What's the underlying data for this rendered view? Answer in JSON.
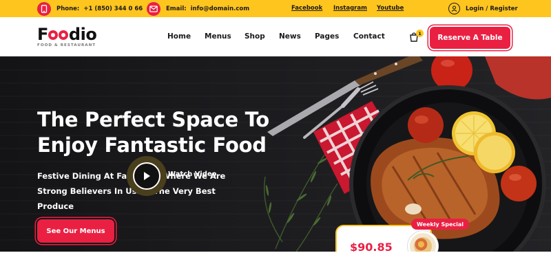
{
  "topbar": {
    "phone_label": "Phone:",
    "phone_value": "+1 (850) 344 0 66",
    "email_label": "Email:",
    "email_value": "info@domain.com",
    "social_links": [
      "Facebook",
      "Instagram",
      "Youtube"
    ],
    "login_label": "Login / Register"
  },
  "brand": {
    "name_start": "F",
    "name_end": "dio",
    "tagline": "FOOD & RESTAURANT"
  },
  "nav": {
    "items": [
      "Home",
      "Menus",
      "Shop",
      "News",
      "Pages",
      "Contact"
    ],
    "cart_count": "1",
    "reserve_label": "Reserve A Table"
  },
  "hero": {
    "title": "The Perfect Space To Enjoy Fantastic Food",
    "subtitle": "Festive Dining At Farthings Where We Are Strong Believers In Using The Very Best Produce",
    "menus_button": "See Our Menus",
    "watch_label": "Watch Video"
  },
  "promo": {
    "tag": "Weekly Special",
    "price": "$90.85"
  },
  "colors": {
    "accent_red": "#ea2043",
    "accent_yellow": "#ffc51f",
    "dark_bg": "#141416"
  },
  "icons": [
    "phone-icon",
    "mail-icon",
    "user-icon",
    "cart-icon",
    "play-icon"
  ]
}
